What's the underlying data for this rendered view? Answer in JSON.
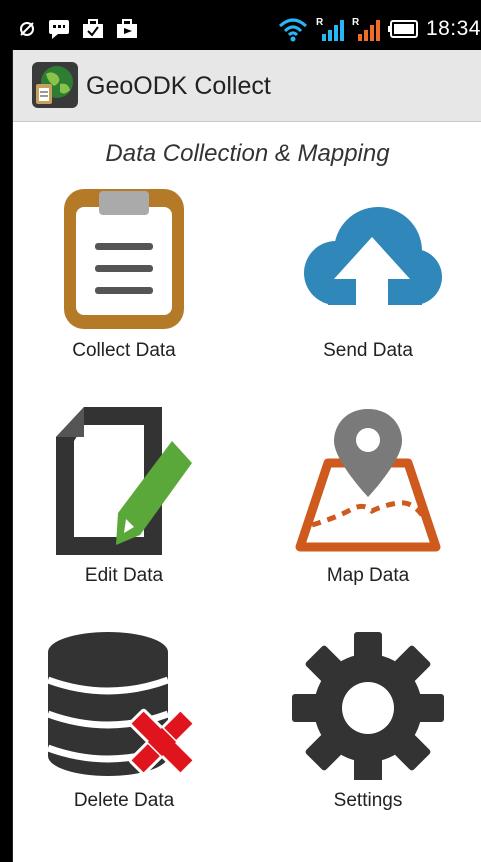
{
  "status_bar": {
    "time": "18:34",
    "icons": [
      "sync-off-icon",
      "chat-icon",
      "briefcase-icon",
      "briefcase-icon",
      "wifi-icon",
      "signal-icon",
      "signal-icon",
      "battery-icon"
    ]
  },
  "action_bar": {
    "title": "GeoODK Collect"
  },
  "main": {
    "subtitle": "Data Collection & Mapping",
    "tiles": [
      {
        "label": "Collect Data",
        "icon": "clipboard-icon",
        "color": "#b47a28"
      },
      {
        "label": "Send Data",
        "icon": "cloud-upload-icon",
        "color": "#2f87ba"
      },
      {
        "label": "Edit Data",
        "icon": "edit-document-icon",
        "color": "#5aa83a"
      },
      {
        "label": "Map Data",
        "icon": "map-pin-icon",
        "color": "#cf5a1d"
      },
      {
        "label": "Delete Data",
        "icon": "database-delete-icon",
        "color": "#e0141d"
      },
      {
        "label": "Settings",
        "icon": "gear-icon",
        "color": "#333333"
      }
    ]
  }
}
